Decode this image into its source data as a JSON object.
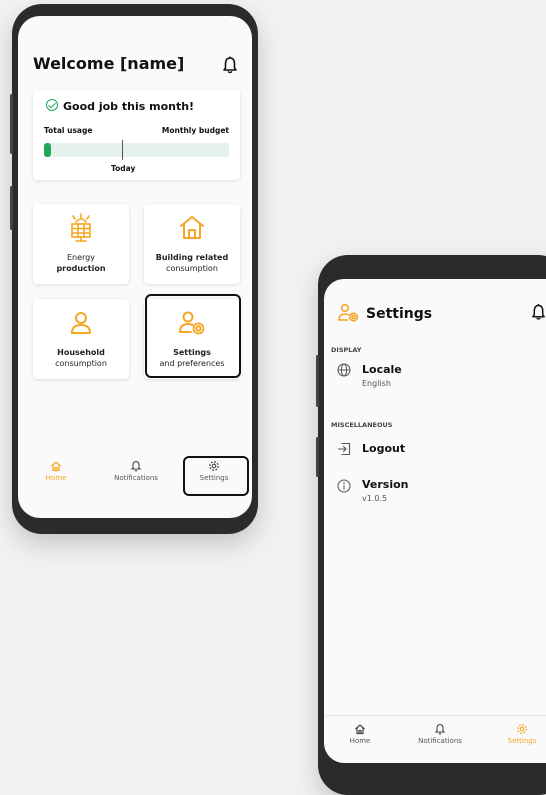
{
  "colors": {
    "accent": "#f5a623",
    "green": "#22a85b"
  },
  "home": {
    "title": "Welcome [name]",
    "summary": {
      "heading": "Good job this month!",
      "left_label": "Total usage",
      "right_label": "Monthly budget",
      "marker_label": "Today",
      "usage_fraction": 0.04
    },
    "tiles": [
      {
        "line1": "Energy",
        "line2": "production",
        "icon": "solar-panel-icon"
      },
      {
        "line1": "Building related",
        "line2": "consumption",
        "icon": "house-icon"
      },
      {
        "line1": "Household",
        "line2": "consumption",
        "icon": "person-icon"
      },
      {
        "line1": "Settings",
        "line2": "and preferences",
        "icon": "user-settings-icon"
      }
    ],
    "tabs": [
      {
        "label": "Home",
        "icon": "home-icon"
      },
      {
        "label": "Notifications",
        "icon": "bell-icon"
      },
      {
        "label": "Settings",
        "icon": "gear-icon"
      }
    ]
  },
  "settings": {
    "title": "Settings",
    "sections": [
      {
        "label": "DISPLAY"
      },
      {
        "label": "MISCELLANEOUS"
      }
    ],
    "locale": {
      "title": "Locale",
      "value": "English"
    },
    "logout": {
      "title": "Logout"
    },
    "version": {
      "title": "Version",
      "value": "v1.0.5"
    },
    "tabs": [
      {
        "label": "Home",
        "icon": "home-icon"
      },
      {
        "label": "Notifications",
        "icon": "bell-icon"
      },
      {
        "label": "Settings",
        "icon": "gear-icon"
      }
    ]
  }
}
